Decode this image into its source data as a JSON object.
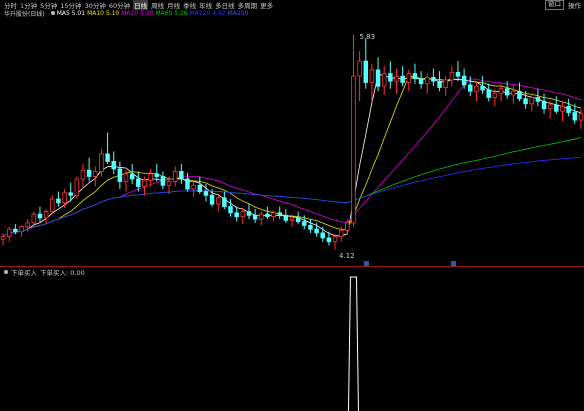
{
  "toolbar": {
    "tabs": [
      {
        "label": "分时",
        "active": false
      },
      {
        "label": "1分钟",
        "active": false
      },
      {
        "label": "5分钟",
        "active": false
      },
      {
        "label": "15分钟",
        "active": false
      },
      {
        "label": "30分钟",
        "active": false
      },
      {
        "label": "60分钟",
        "active": false
      },
      {
        "label": "日线",
        "active": true
      },
      {
        "label": "周线",
        "active": false
      },
      {
        "label": "月线",
        "active": false
      },
      {
        "label": "季线",
        "active": false
      },
      {
        "label": "年线",
        "active": false
      },
      {
        "label": "多日线",
        "active": false
      },
      {
        "label": "多周期",
        "active": false
      },
      {
        "label": "更多",
        "active": false
      }
    ],
    "right_buttons": [
      "窗口",
      "操作"
    ]
  },
  "main": {
    "title": "华升股份(日线)",
    "indicators": [
      {
        "label": "MA5",
        "value": "5.01",
        "color": "#ffffff"
      },
      {
        "label": "MA10",
        "value": "5.10",
        "color": "#e6e600"
      },
      {
        "label": "MA20",
        "value": "5.20",
        "color": "#e000e0"
      },
      {
        "label": "MA60",
        "value": "5.26",
        "color": "#00c800"
      },
      {
        "label": "MA120",
        "value": "4.92",
        "color": "#3030ff"
      },
      {
        "label": "MA250",
        "value": "",
        "color": "#5050ff"
      }
    ],
    "high_label": "5.83",
    "low_label": "4.12"
  },
  "sub": {
    "legend": "下单买入",
    "legend_value": "下单买入: 0.00"
  },
  "colors": {
    "up": "#ff3232",
    "down": "#54ffff",
    "divider": "#9a1b1b",
    "background": "#000000",
    "ma5": "#ffffff",
    "ma10": "#e6e600",
    "ma20": "#e000e0",
    "ma60": "#00c800",
    "ma120": "#3030ff"
  },
  "chart_data": {
    "type": "candlestick",
    "x": [
      1,
      2,
      3,
      4,
      5,
      6,
      7,
      8,
      9,
      10,
      11,
      12,
      13,
      14,
      15,
      16,
      17,
      18,
      19,
      20,
      21,
      22,
      23,
      24,
      25,
      26,
      27,
      28,
      29,
      30,
      31,
      32,
      33,
      34,
      35,
      36,
      37,
      38,
      39,
      40,
      41,
      42,
      43,
      44,
      45,
      46,
      47,
      48,
      49,
      50,
      51,
      52,
      53,
      54,
      55,
      56,
      57,
      58,
      59,
      60,
      61,
      62,
      63,
      64,
      65,
      66,
      67,
      68,
      69,
      70,
      71,
      72,
      73,
      74,
      75,
      76,
      77,
      78,
      79,
      80,
      81,
      82,
      83,
      84,
      85,
      86,
      87,
      88,
      89,
      90,
      91,
      92,
      93,
      94,
      95,
      96,
      97,
      98,
      99,
      100,
      101,
      102,
      103,
      104,
      105
    ],
    "price_range": [
      4.05,
      5.9
    ],
    "series": [
      {
        "name": "candles",
        "values": [
          [
            4.2,
            4.25,
            4.15,
            4.22
          ],
          [
            4.22,
            4.3,
            4.18,
            4.28
          ],
          [
            4.28,
            4.32,
            4.24,
            4.26
          ],
          [
            4.26,
            4.31,
            4.22,
            4.3
          ],
          [
            4.3,
            4.36,
            4.26,
            4.33
          ],
          [
            4.33,
            4.42,
            4.3,
            4.4
          ],
          [
            4.4,
            4.46,
            4.34,
            4.37
          ],
          [
            4.37,
            4.44,
            4.32,
            4.42
          ],
          [
            4.42,
            4.55,
            4.4,
            4.52
          ],
          [
            4.52,
            4.58,
            4.46,
            4.49
          ],
          [
            4.49,
            4.6,
            4.45,
            4.57
          ],
          [
            4.57,
            4.65,
            4.5,
            4.55
          ],
          [
            4.55,
            4.7,
            4.52,
            4.68
          ],
          [
            4.68,
            4.8,
            4.6,
            4.75
          ],
          [
            4.75,
            4.85,
            4.66,
            4.7
          ],
          [
            4.7,
            4.78,
            4.62,
            4.74
          ],
          [
            4.74,
            4.92,
            4.7,
            4.88
          ],
          [
            4.88,
            5.05,
            4.8,
            4.82
          ],
          [
            4.82,
            4.9,
            4.72,
            4.76
          ],
          [
            4.76,
            4.82,
            4.6,
            4.66
          ],
          [
            4.66,
            4.75,
            4.58,
            4.72
          ],
          [
            4.72,
            4.8,
            4.64,
            4.68
          ],
          [
            4.68,
            4.74,
            4.58,
            4.62
          ],
          [
            4.62,
            4.7,
            4.55,
            4.67
          ],
          [
            4.67,
            4.76,
            4.62,
            4.72
          ],
          [
            4.72,
            4.8,
            4.66,
            4.7
          ],
          [
            4.7,
            4.74,
            4.6,
            4.63
          ],
          [
            4.63,
            4.7,
            4.56,
            4.66
          ],
          [
            4.66,
            4.78,
            4.62,
            4.74
          ],
          [
            4.74,
            4.8,
            4.64,
            4.68
          ],
          [
            4.68,
            4.73,
            4.58,
            4.6
          ],
          [
            4.6,
            4.66,
            4.54,
            4.63
          ],
          [
            4.63,
            4.7,
            4.56,
            4.58
          ],
          [
            4.58,
            4.64,
            4.5,
            4.55
          ],
          [
            4.55,
            4.6,
            4.46,
            4.48
          ],
          [
            4.48,
            4.56,
            4.42,
            4.53
          ],
          [
            4.53,
            4.58,
            4.44,
            4.46
          ],
          [
            4.46,
            4.52,
            4.38,
            4.41
          ],
          [
            4.41,
            4.46,
            4.34,
            4.38
          ],
          [
            4.38,
            4.45,
            4.32,
            4.42
          ],
          [
            4.42,
            4.48,
            4.36,
            4.39
          ],
          [
            4.39,
            4.44,
            4.33,
            4.36
          ],
          [
            4.36,
            4.42,
            4.31,
            4.4
          ],
          [
            4.4,
            4.46,
            4.36,
            4.38
          ],
          [
            4.38,
            4.43,
            4.34,
            4.41
          ],
          [
            4.41,
            4.46,
            4.36,
            4.39
          ],
          [
            4.39,
            4.44,
            4.33,
            4.35
          ],
          [
            4.35,
            4.4,
            4.3,
            4.37
          ],
          [
            4.37,
            4.42,
            4.32,
            4.34
          ],
          [
            4.34,
            4.39,
            4.28,
            4.31
          ],
          [
            4.31,
            4.36,
            4.25,
            4.28
          ],
          [
            4.28,
            4.33,
            4.22,
            4.25
          ],
          [
            4.25,
            4.3,
            4.18,
            4.21
          ],
          [
            4.21,
            4.26,
            4.15,
            4.18
          ],
          [
            4.18,
            4.24,
            4.12,
            4.22
          ],
          [
            4.22,
            4.3,
            4.18,
            4.27
          ],
          [
            4.27,
            4.36,
            4.24,
            4.33
          ],
          [
            4.33,
            5.83,
            4.3,
            5.5
          ],
          [
            5.5,
            5.7,
            5.3,
            5.62
          ],
          [
            5.62,
            5.8,
            5.4,
            5.45
          ],
          [
            5.45,
            5.6,
            5.3,
            5.55
          ],
          [
            5.55,
            5.65,
            5.38,
            5.42
          ],
          [
            5.42,
            5.58,
            5.35,
            5.52
          ],
          [
            5.52,
            5.62,
            5.4,
            5.46
          ],
          [
            5.46,
            5.56,
            5.36,
            5.5
          ],
          [
            5.5,
            5.58,
            5.42,
            5.45
          ],
          [
            5.45,
            5.55,
            5.38,
            5.52
          ],
          [
            5.52,
            5.6,
            5.44,
            5.48
          ],
          [
            5.48,
            5.54,
            5.4,
            5.44
          ],
          [
            5.44,
            5.52,
            5.36,
            5.49
          ],
          [
            5.49,
            5.56,
            5.42,
            5.46
          ],
          [
            5.46,
            5.54,
            5.38,
            5.41
          ],
          [
            5.41,
            5.5,
            5.34,
            5.47
          ],
          [
            5.47,
            5.58,
            5.42,
            5.53
          ],
          [
            5.53,
            5.62,
            5.46,
            5.5
          ],
          [
            5.5,
            5.56,
            5.4,
            5.43
          ],
          [
            5.43,
            5.5,
            5.34,
            5.38
          ],
          [
            5.38,
            5.46,
            5.3,
            5.42
          ],
          [
            5.42,
            5.5,
            5.36,
            5.39
          ],
          [
            5.39,
            5.44,
            5.3,
            5.33
          ],
          [
            5.33,
            5.4,
            5.26,
            5.36
          ],
          [
            5.36,
            5.44,
            5.3,
            5.4
          ],
          [
            5.4,
            5.46,
            5.32,
            5.35
          ],
          [
            5.35,
            5.42,
            5.28,
            5.38
          ],
          [
            5.38,
            5.45,
            5.3,
            5.32
          ],
          [
            5.32,
            5.38,
            5.24,
            5.28
          ],
          [
            5.28,
            5.36,
            5.22,
            5.33
          ],
          [
            5.33,
            5.4,
            5.26,
            5.3
          ],
          [
            5.3,
            5.36,
            5.2,
            5.24
          ],
          [
            5.24,
            5.3,
            5.16,
            5.27
          ],
          [
            5.27,
            5.34,
            5.2,
            5.22
          ],
          [
            5.22,
            5.3,
            5.14,
            5.26
          ],
          [
            5.26,
            5.32,
            5.18,
            5.21
          ],
          [
            5.21,
            5.28,
            5.12,
            5.15
          ],
          [
            5.15,
            5.24,
            5.08,
            5.2
          ]
        ]
      }
    ],
    "signal": {
      "name": "下单买入",
      "spike_index": 57,
      "value": 1
    }
  }
}
